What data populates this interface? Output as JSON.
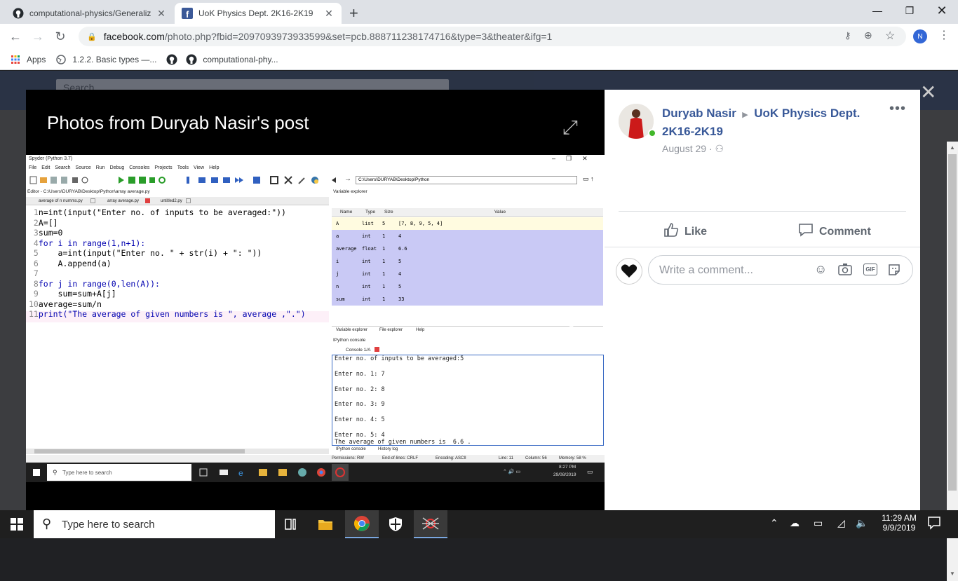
{
  "tabs": [
    {
      "title": "computational-physics/Generaliz",
      "active": false
    },
    {
      "title": "UoK Physics Dept. 2K16-2K19",
      "active": true
    }
  ],
  "address": {
    "host": "facebook.com",
    "path": "/photo.php?fbid=2097093973933599&set=pcb.888711238174716&type=3&theater&ifg=1"
  },
  "account_initial": "N",
  "bookmarks": [
    "Apps",
    "1.2.2. Basic types —...",
    "computational-phy..."
  ],
  "fb": {
    "search_placeholder": "Search",
    "photo_title": "Photos from Duryab Nasir's post",
    "author": "Duryab Nasir",
    "group": "UoK Physics Dept. 2K16-2K19",
    "date": "August 29 ·",
    "like": "Like",
    "comment": "Comment",
    "comment_placeholder": "Write a comment..."
  },
  "spyder": {
    "window_title": "Spyder (Python 3.7)",
    "menu": [
      "File",
      "Edit",
      "Search",
      "Source",
      "Run",
      "Debug",
      "Consoles",
      "Projects",
      "Tools",
      "View",
      "Help"
    ],
    "path": "C:\\Users\\DURYAB\\Desktop\\Python",
    "editor_path": "Editor - C:\\Users\\DURYAB\\Desktop\\Python\\array average.py",
    "editor_tabs": [
      "average of n numms.py",
      "array average.py",
      "untitled2.py"
    ],
    "code_lines": [
      {
        "n": "1",
        "text": "n=int(input(\"Enter no. of inputs to be averaged:\"))"
      },
      {
        "n": "2",
        "text": "A=[]"
      },
      {
        "n": "3",
        "text": "sum=0"
      },
      {
        "n": "4",
        "text": "for i in range(1,n+1):"
      },
      {
        "n": "5",
        "text": "    a=int(input(\"Enter no. \" + str(i) + \": \"))"
      },
      {
        "n": "6",
        "text": "    A.append(a)"
      },
      {
        "n": "7",
        "text": ""
      },
      {
        "n": "8",
        "text": "for j in range(0,len(A)):"
      },
      {
        "n": "9",
        "text": "    sum=sum+A[j]"
      },
      {
        "n": "10",
        "text": "average=sum/n"
      },
      {
        "n": "11",
        "text": "print(\"The average of given numbers is \", average ,\".\")"
      }
    ],
    "var_explorer_title": "Variable explorer",
    "var_headers": [
      "Name",
      "Type",
      "Size",
      "Value"
    ],
    "variables": [
      [
        "A",
        "list",
        "5",
        "[7, 8, 9, 5, 4]"
      ],
      [
        "a",
        "int",
        "1",
        "4"
      ],
      [
        "average",
        "float",
        "1",
        "6.6"
      ],
      [
        "i",
        "int",
        "1",
        "5"
      ],
      [
        "j",
        "int",
        "1",
        "4"
      ],
      [
        "n",
        "int",
        "1",
        "5"
      ],
      [
        "sum",
        "int",
        "1",
        "33"
      ]
    ],
    "var_tabs": [
      "Variable explorer",
      "File explorer",
      "Help"
    ],
    "console_title": "IPython console",
    "console_tab": "Console 1/A",
    "console_lines": [
      "Enter no. of inputs to be averaged:5",
      "",
      "Enter no. 1: 7",
      "",
      "Enter no. 2: 8",
      "",
      "Enter no. 3: 9",
      "",
      "Enter no. 4: 5",
      "",
      "Enter no. 5: 4",
      "The average of given numbers is  6.6 ."
    ],
    "console_tabs": [
      "IPython console",
      "History log"
    ],
    "status": {
      "permissions": "Permissions: RW",
      "eol": "End-of-lines: CRLF",
      "encoding": "Encoding: ASCII",
      "line": "Line: 11",
      "column": "Column: 56",
      "memory": "Memory: 58 %"
    },
    "inner_search": "Type here to search",
    "inner_time": "8:27 PM",
    "inner_date": "29/08/2019"
  },
  "taskbar": {
    "search": "Type here to search",
    "time": "11:29 AM",
    "date": "9/9/2019"
  }
}
